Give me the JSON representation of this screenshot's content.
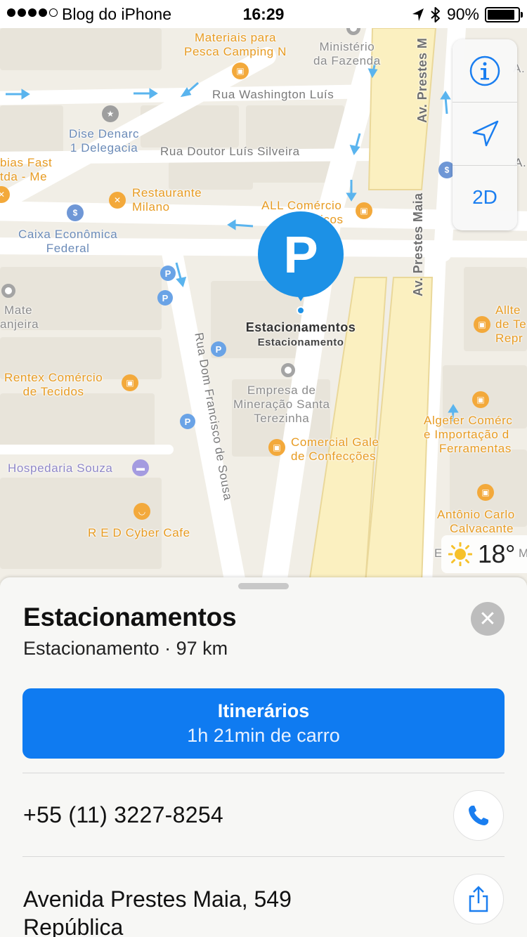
{
  "status_bar": {
    "carrier": "Blog do iPhone",
    "time": "16:29",
    "battery": "90%"
  },
  "map": {
    "labels": {
      "materiais_1": "Materiais para",
      "materiais_2": "Pesca Camping N",
      "ministerio_1": "Ministério",
      "ministerio_2": "da Fazenda",
      "rua_washington": "Rua Washington Luís",
      "dise_1": "Dise Denarc",
      "dise_2": "1 Delegacia",
      "rua_doutor": "Rua Doutor Luís Silveira",
      "bias_1": "bias Fast",
      "bias_2": "tda - Me",
      "restaurante_1": "Restaurante",
      "restaurante_2": "Milano",
      "all_1": "ALL Comércio",
      "all_2": "icos",
      "caixa_1": "Caixa Econômica",
      "caixa_2": "Federal",
      "mate_1": "Mate",
      "mate_2": "anjeira",
      "rentex_1": "Rentex Comércio",
      "rentex_2": "de Tecidos",
      "empresa_1": "Empresa de",
      "empresa_2": "Mineração Santa",
      "empresa_3": "Terezinha",
      "comercial_1": "Comercial Gale",
      "comercial_2": "de Confecções",
      "hospedaria": "Hospedaria Souza",
      "red": "R E D Cyber Cafe",
      "alltex_1": "Allte",
      "alltex_2": "de Te",
      "alltex_3": "Repr",
      "algefer_1": "Algefer Comérc",
      "algefer_2": "e Importação d",
      "algefer_3": "Ferramentas",
      "antonio_1": "Antônio Carlo",
      "antonio_2": "Calvacante",
      "right_a": "A.",
      "right_ma": "M",
      "rua_dom": "Rua Dom Francisco de Sousa",
      "av_prestes_top": "Av. Prestes M",
      "av_prestes_mid": "Av. Prestes Maia",
      "weather_e": "E"
    },
    "pin": {
      "letter": "P",
      "title": "Estacionamentos",
      "subtitle": "Estacionamento"
    },
    "controls": {
      "toggle_label": "2D"
    },
    "weather": {
      "temperature": "18°"
    }
  },
  "sheet": {
    "title": "Estacionamentos",
    "subtitle": "Estacionamento · 97 km",
    "route": {
      "title": "Itinerários",
      "duration": "1h 21min de carro"
    },
    "phone": "+55 (11) 3227-8254",
    "address_line1": "Avenida Prestes Maia, 549",
    "address_line2": "República"
  },
  "colors": {
    "accent": "#0f7bf1",
    "pin": "#1c91e6",
    "poi_orange": "#e79b22",
    "road_yellow": "#fbf0c0"
  }
}
